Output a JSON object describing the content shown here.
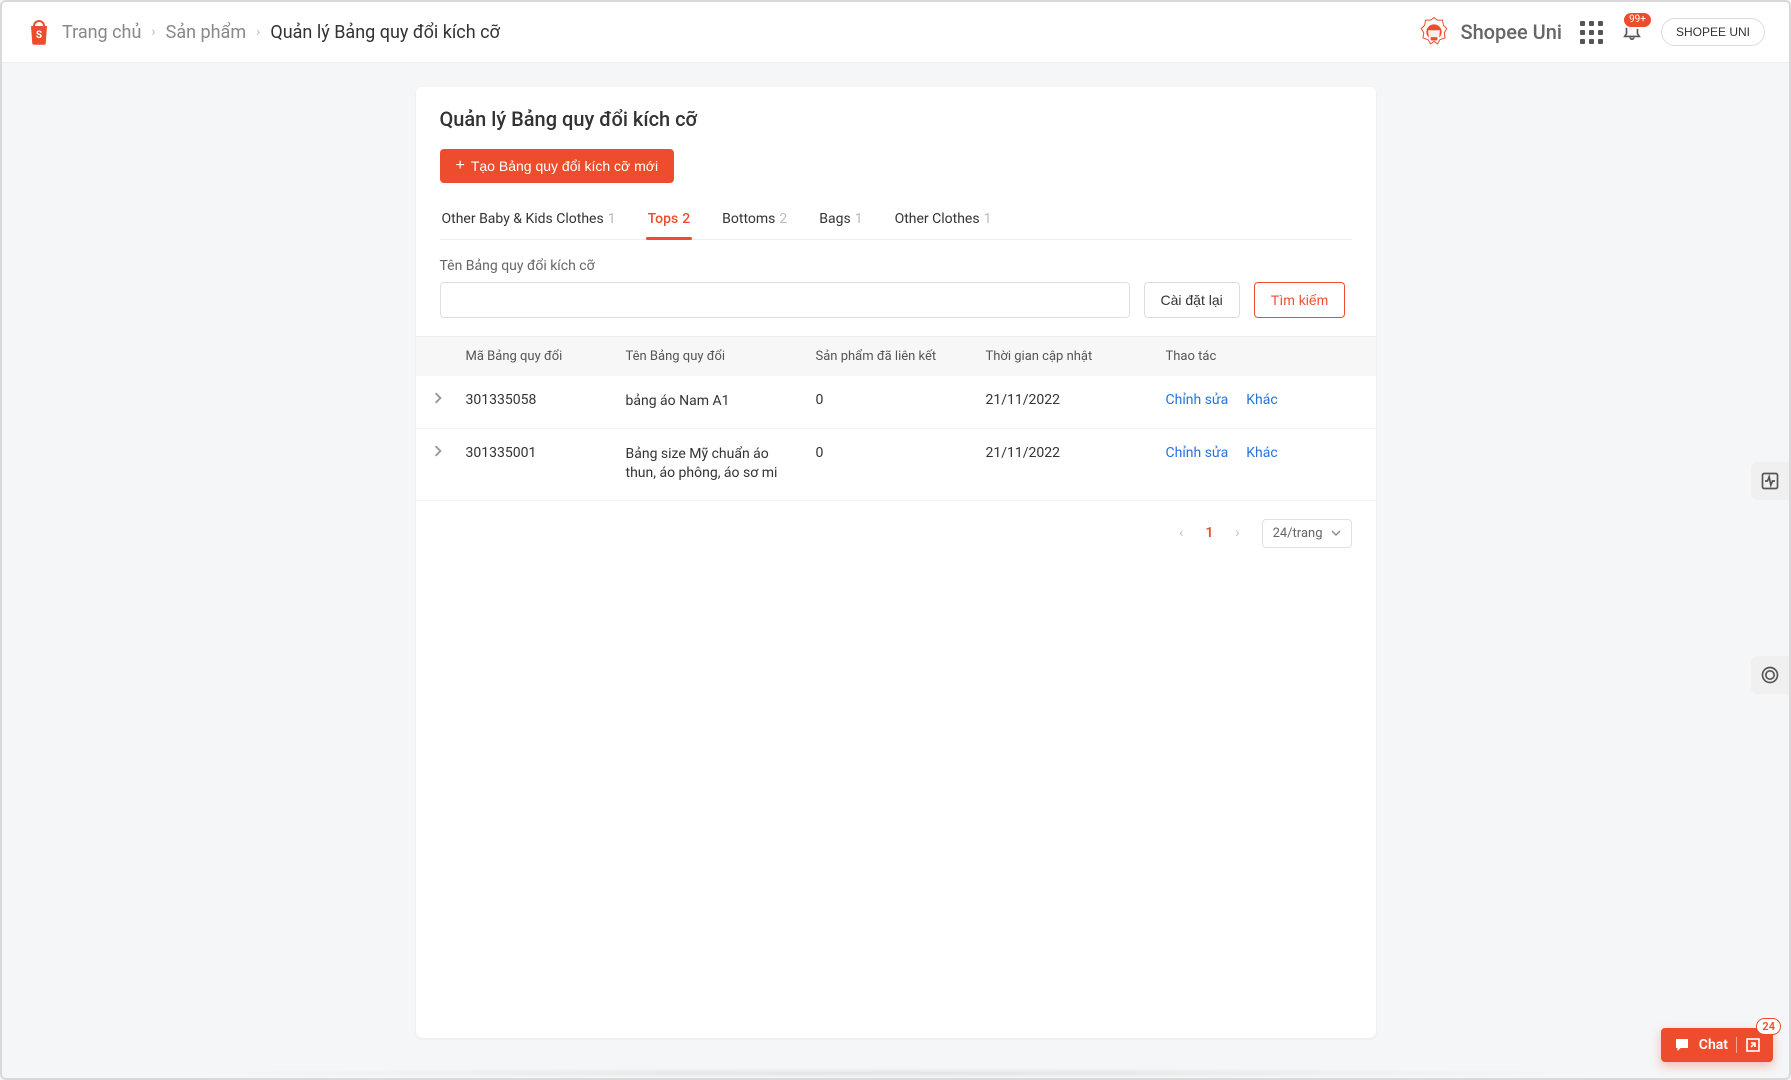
{
  "colors": {
    "accent": "#ee4d2d",
    "link": "#2673dd"
  },
  "header": {
    "breadcrumb": {
      "home": "Trang chủ",
      "products": "Sản phẩm",
      "current": "Quản lý Bảng quy đổi kích cỡ"
    },
    "brand": "Shopee Uni",
    "notification_badge": "99+",
    "shopee_uni_button": "SHOPEE UNI"
  },
  "page": {
    "title": "Quản lý Bảng quy đổi kích cỡ",
    "create_button": "Tạo Bảng quy đổi kích cỡ mới",
    "plus": "+"
  },
  "tabs": [
    {
      "label": "Other Baby & Kids Clothes",
      "count": "1",
      "active": false
    },
    {
      "label": "Tops",
      "count": "2",
      "active": true
    },
    {
      "label": "Bottoms",
      "count": "2",
      "active": false
    },
    {
      "label": "Bags",
      "count": "1",
      "active": false
    },
    {
      "label": "Other Clothes",
      "count": "1",
      "active": false
    }
  ],
  "filter": {
    "label": "Tên Bảng quy đổi kích cỡ",
    "value": "",
    "reset": "Cài đặt lại",
    "search": "Tìm kiếm"
  },
  "table": {
    "columns": {
      "id": "Mã Bảng quy đổi",
      "name": "Tên Bảng quy đổi",
      "linked": "Sản phẩm đã liên kết",
      "updated": "Thời gian cập nhật",
      "actions": "Thao tác"
    },
    "rows": [
      {
        "id": "301335058",
        "name": "bảng áo Nam A1",
        "linked": "0",
        "updated": "21/11/2022",
        "edit": "Chỉnh sửa",
        "other": "Khác"
      },
      {
        "id": "301335001",
        "name": "Bảng size Mỹ chuẩn áo thun, áo phông, áo sơ mi",
        "linked": "0",
        "updated": "21/11/2022",
        "edit": "Chỉnh sửa",
        "other": "Khác"
      }
    ]
  },
  "pager": {
    "page": "1",
    "page_size_label": "24/trang"
  },
  "chat": {
    "label": "Chat",
    "badge": "24"
  }
}
